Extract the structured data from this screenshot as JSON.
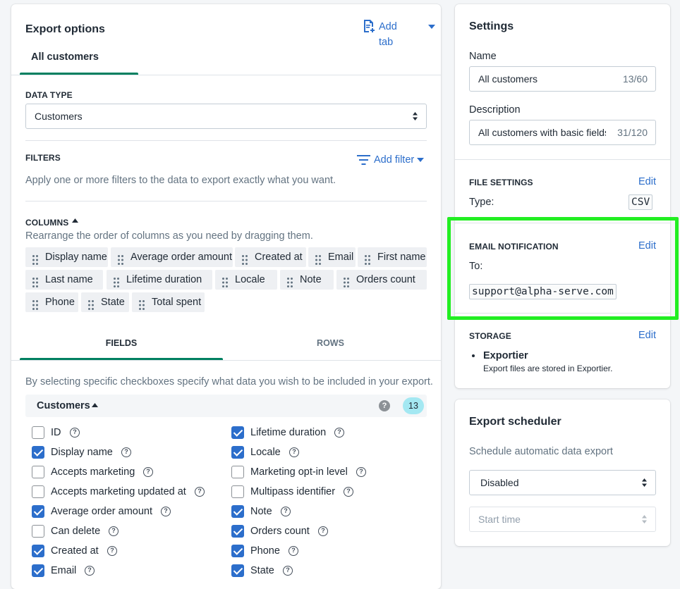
{
  "export_options": {
    "title": "Export options",
    "add_tab": "Add tab",
    "tabs": [
      "All customers"
    ],
    "data_type": {
      "label": "DATA TYPE",
      "value": "Customers"
    },
    "filters": {
      "label": "FILTERS",
      "add_filter": "Add filter",
      "help": "Apply one or more filters to the data to export exactly what you want."
    },
    "columns": {
      "label": "COLUMNS",
      "help": "Rearrange the order of columns as you need by dragging them.",
      "chips": [
        "Display name",
        "Average order amount",
        "Created at",
        "Email",
        "First name",
        "Last name",
        "Lifetime duration",
        "Locale",
        "Note",
        "Orders count",
        "Phone",
        "State",
        "Total spent"
      ]
    },
    "subtabs": [
      "FIELDS",
      "ROWS"
    ],
    "fields_help": "By selecting specific checkboxes specify what data you wish to be included in your export.",
    "group": {
      "name": "Customers",
      "count": "13"
    },
    "fields_left": [
      {
        "label": "ID",
        "checked": false
      },
      {
        "label": "Display name",
        "checked": true
      },
      {
        "label": "Accepts marketing",
        "checked": false
      },
      {
        "label": "Accepts marketing updated at",
        "checked": false
      },
      {
        "label": "Average order amount",
        "checked": true
      },
      {
        "label": "Can delete",
        "checked": false
      },
      {
        "label": "Created at",
        "checked": true
      },
      {
        "label": "Email",
        "checked": true
      }
    ],
    "fields_right": [
      {
        "label": "Lifetime duration",
        "checked": true
      },
      {
        "label": "Locale",
        "checked": true
      },
      {
        "label": "Marketing opt-in level",
        "checked": false
      },
      {
        "label": "Multipass identifier",
        "checked": false
      },
      {
        "label": "Note",
        "checked": true
      },
      {
        "label": "Orders count",
        "checked": true
      },
      {
        "label": "Phone",
        "checked": true
      },
      {
        "label": "State",
        "checked": true
      }
    ]
  },
  "settings": {
    "title": "Settings",
    "name_label": "Name",
    "name_value": "All customers",
    "name_count": "13/60",
    "desc_label": "Description",
    "desc_value": "All customers with basic fields",
    "desc_count": "31/120",
    "file_settings": {
      "label": "FILE SETTINGS",
      "edit": "Edit",
      "type_label": "Type:",
      "type_value": "CSV"
    },
    "email": {
      "label": "EMAIL NOTIFICATION",
      "edit": "Edit",
      "to_label": "To:",
      "address": "support@alpha-serve.com"
    },
    "storage": {
      "label": "STORAGE",
      "edit": "Edit",
      "name": "Exportier",
      "desc": "Export files are stored in Exportier."
    }
  },
  "scheduler": {
    "title": "Export scheduler",
    "help": "Schedule automatic data export",
    "mode": "Disabled",
    "start_time_placeholder": "Start time"
  },
  "colors": {
    "accent": "#2c6ecb",
    "tab_underline": "#008060",
    "highlight": "#22ee22"
  }
}
